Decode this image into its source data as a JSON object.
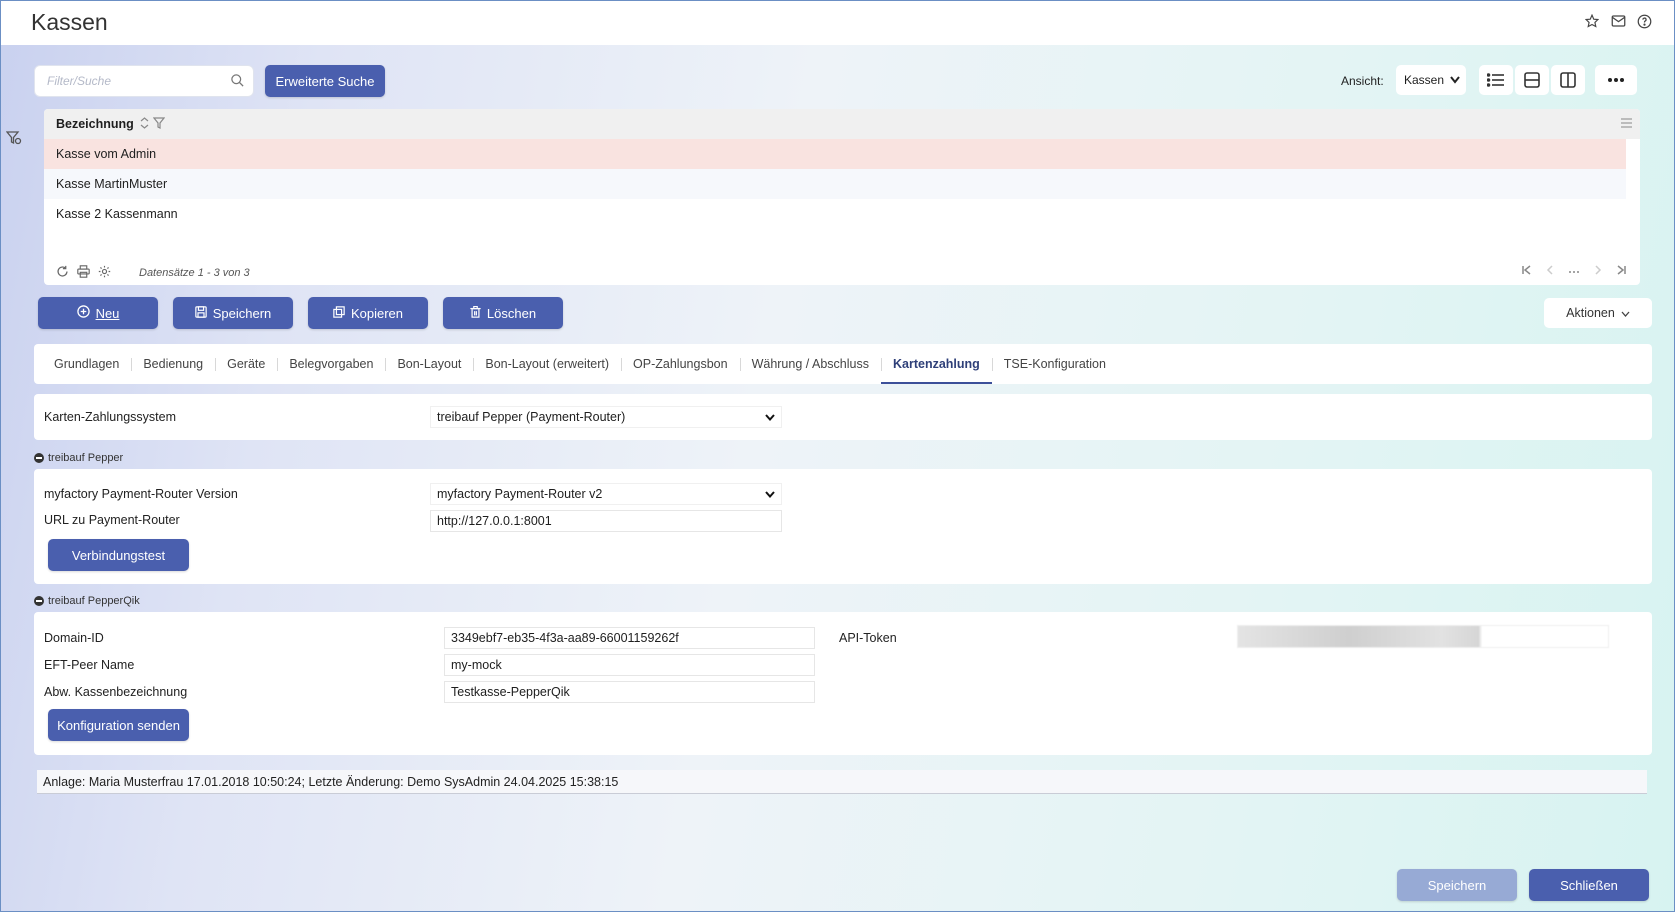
{
  "window": {
    "title": "Kassen"
  },
  "titlebar_icons": [
    "star-icon",
    "mail-icon",
    "help-icon"
  ],
  "toolbar": {
    "search_placeholder": "Filter/Suche",
    "extended_search_label": "Erweiterte Suche",
    "view_label": "Ansicht:",
    "view_selected": "Kassen"
  },
  "grid": {
    "column_header": "Bezeichnung",
    "rows": [
      "Kasse vom Admin",
      "Kasse MartinMuster",
      "Kasse 2 Kassenmann"
    ],
    "selected_row": 0,
    "record_info": "Datensätze 1 - 3 von 3"
  },
  "actions": {
    "new_label": "Neu",
    "save_label": "Speichern",
    "copy_label": "Kopieren",
    "delete_label": "Löschen",
    "actions_menu_label": "Aktionen"
  },
  "tabs": [
    "Grundlagen",
    "Bedienung",
    "Geräte",
    "Belegvorgaben",
    "Bon-Layout",
    "Bon-Layout (erweitert)",
    "OP-Zahlungsbon",
    "Währung / Abschluss",
    "Kartenzahlung",
    "TSE-Konfiguration"
  ],
  "active_tab": "Kartenzahlung",
  "payment": {
    "system_label": "Karten-Zahlungssystem",
    "system_value": "treibauf Pepper (Payment-Router)"
  },
  "pepper": {
    "section_title": "treibauf Pepper",
    "version_label": "myfactory Payment-Router Version",
    "version_value": "myfactory Payment-Router v2",
    "url_label": "URL zu Payment-Router",
    "url_value": "http://127.0.0.1:8001",
    "test_button": "Verbindungstest"
  },
  "pepperqik": {
    "section_title": "treibauf PepperQik",
    "domain_label": "Domain-ID",
    "domain_value": "3349ebf7-eb35-4f3a-aa89-66001159262f",
    "peer_label": "EFT-Peer Name",
    "peer_value": "my-mock",
    "kasse_label": "Abw. Kassenbezeichnung",
    "kasse_value": "Testkasse-PepperQik",
    "token_label": "API-Token",
    "send_button": "Konfiguration senden"
  },
  "status": {
    "text": "Anlage: Maria Musterfrau 17.01.2018 10:50:24; Letzte Änderung: Demo SysAdmin 24.04.2025 15:38:15"
  },
  "footer": {
    "save_label": "Speichern",
    "close_label": "Schließen"
  }
}
